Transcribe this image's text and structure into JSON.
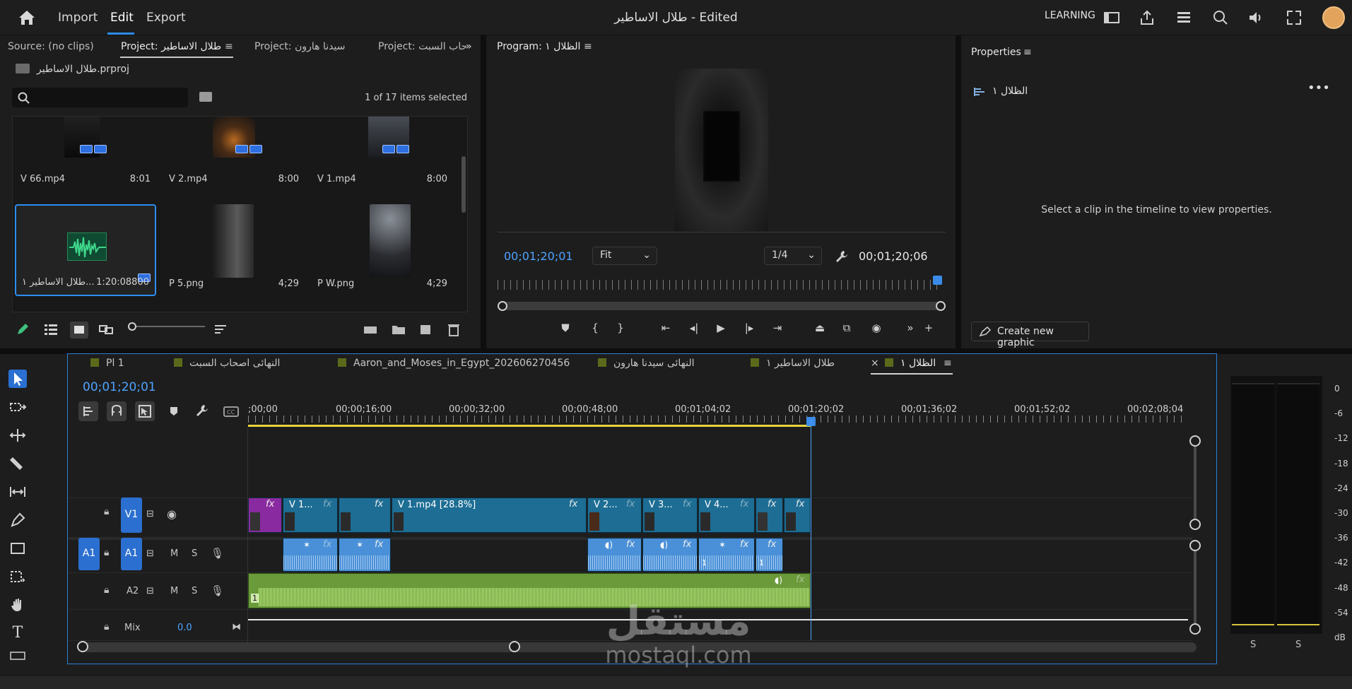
{
  "header": {
    "menu": [
      "Import",
      "Edit",
      "Export"
    ],
    "active_menu": "Edit",
    "title": "طلال الاساطير - Edited",
    "workspace": "LEARNING"
  },
  "project_panel": {
    "tabs": [
      "Source: (no clips)",
      "Project: طلال الاساطير",
      "Project: سيدنا هارون",
      "Project: حاب السبت"
    ],
    "project_file": "طلال الاساطير.prproj",
    "search_placeholder": "",
    "items_count": "1 of 17 items selected",
    "items": [
      {
        "name": "V 66.mp4",
        "duration": "8:01"
      },
      {
        "name": "V 2.mp4",
        "duration": "8:00"
      },
      {
        "name": "V 1.mp4",
        "duration": "8:00"
      },
      {
        "name": "طلال الاساطير ١...",
        "duration": "1:20:08800",
        "selected": true
      },
      {
        "name": "P 5.png",
        "duration": "4;29"
      },
      {
        "name": "P W.png",
        "duration": "4;29"
      }
    ]
  },
  "program_monitor": {
    "title": "Program: الظلال ١",
    "current_tc": "00;01;20;01",
    "fit": "Fit",
    "resolution": "1/4",
    "duration_tc": "00;01;20;06"
  },
  "properties": {
    "title": "Properties",
    "sequence_name": "الظلال ١",
    "message": "Select a clip in the timeline to view properties.",
    "create_button": "Create new graphic"
  },
  "timeline": {
    "tabs": [
      "Pl 1",
      "النهائى اصحاب السبت",
      "Aaron_and_Moses_in_Egypt_202606270456",
      "النهائى سيدنا هارون",
      "طلال الاساطير ١",
      "الظلال ١"
    ],
    "active_tab": "الظلال ١",
    "current_tc": "00;01;20;01",
    "ruler_labels": [
      ";00;00",
      "00;00;16;00",
      "00;00;32;00",
      "00;00;48;00",
      "00;01;04;02",
      "00;01;20;02",
      "00;01;36;02",
      "00;01;52;02",
      "00;02;08;04"
    ],
    "tracks": {
      "v1": "V1",
      "a1_source": "A1",
      "a1": "A1",
      "a2": "A2",
      "mix": "Mix",
      "mix_value": "0.0",
      "m": "M",
      "s": "S"
    },
    "clips": {
      "v1_1": "V 1...",
      "v1_main": "V 1.mp4 [28.8%]",
      "v2": "V 2...",
      "v3": "V 3...",
      "v4": "V 4...",
      "fx": "fx",
      "a1_num": "1",
      "a2_num": "1"
    },
    "playhead_percent": 59.6
  },
  "meters": {
    "db_labels": [
      "0",
      "-6",
      "-12",
      "-18",
      "-24",
      "-30",
      "-36",
      "-42",
      "-48",
      "-54",
      "dB"
    ],
    "channel_labels": [
      "S",
      "S"
    ]
  },
  "watermark": {
    "arabic": "مستقل",
    "latin": "mostaql.com"
  }
}
